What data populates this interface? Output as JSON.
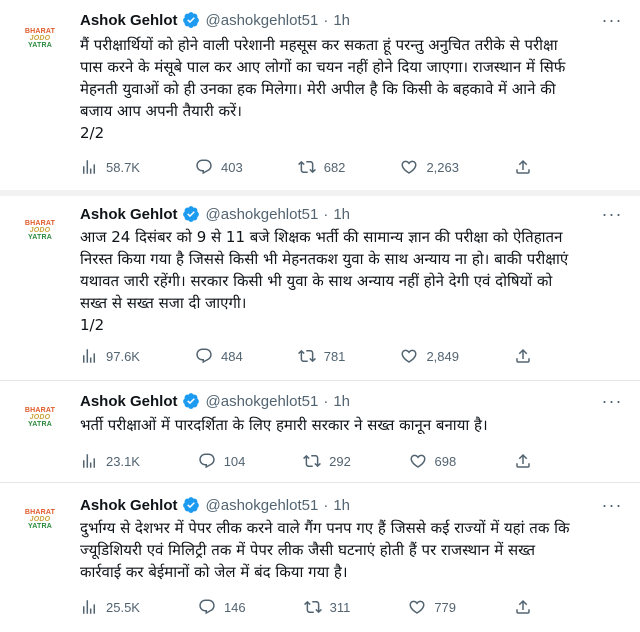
{
  "tweets": [
    {
      "author_name": "Ashok Gehlot",
      "handle": "@ashokgehlot51",
      "separator": "·",
      "time": "1h",
      "avatar_lines": [
        "BHARAT",
        "JODO",
        "YATRA"
      ],
      "lines": [
        "मैं परीक्षार्थियों को होने वाली परेशानी महसूस कर सकता हूं परन्तु अनुचित तरीके से परीक्षा",
        "पास करने के मंसूबे पाल कर आए लोगों का चयन नहीं होने दिया जाएगा। राजस्थान में सिर्फ",
        "मेहनती युवाओं को ही उनका हक मिलेगा। मेरी अपील है कि किसी के बहकावे में आने की",
        "बजाय आप अपनी तैयारी करें।",
        "2/2"
      ],
      "views": "58.7K",
      "replies": "403",
      "retweets": "682",
      "likes": "2,263"
    },
    {
      "author_name": "Ashok Gehlot",
      "handle": "@ashokgehlot51",
      "separator": "·",
      "time": "1h",
      "avatar_lines": [
        "BHARAT",
        "JODO",
        "YATRA"
      ],
      "lines": [
        "आज 24 दिसंबर को 9 से 11 बजे शिक्षक भर्ती की सामान्य ज्ञान की परीक्षा को ऐतिहातन",
        "निरस्त किया गया है जिससे किसी भी मेहनतकश युवा के साथ अन्याय ना हो। बाकी परीक्षाएं",
        "यथावत जारी रहेंगी। सरकार किसी भी युवा के साथ अन्याय नहीं होने देगी एवं दोषियों को",
        "सख्त से सख्त सजा दी जाएगी।",
        "1/2"
      ],
      "views": "97.6K",
      "replies": "484",
      "retweets": "781",
      "likes": "2,849"
    },
    {
      "author_name": "Ashok Gehlot",
      "handle": "@ashokgehlot51",
      "separator": "·",
      "time": "1h",
      "avatar_lines": [
        "BHARAT",
        "JODO",
        "YATRA"
      ],
      "lines": [
        "भर्ती परीक्षाओं में पारदर्शिता के लिए हमारी सरकार ने सख्त कानून बनाया है।"
      ],
      "views": "23.1K",
      "replies": "104",
      "retweets": "292",
      "likes": "698"
    },
    {
      "author_name": "Ashok Gehlot",
      "handle": "@ashokgehlot51",
      "separator": "·",
      "time": "1h",
      "avatar_lines": [
        "BHARAT",
        "JODO",
        "YATRA"
      ],
      "lines": [
        "दुर्भाग्य से देशभर में पेपर लीक करने वाले गैंग पनप गए हैं जिससे कई राज्यों में यहां तक कि",
        "ज्यूडिशियरी एवं मिलिट्री तक में पेपर लीक जैसी घटनाएं होती हैं पर राजस्थान में सख्त",
        "कार्रवाई कर बेईमानों को जेल में बंद किया गया है।"
      ],
      "views": "25.5K",
      "replies": "146",
      "retweets": "311",
      "likes": "779"
    }
  ],
  "colors": {
    "text": "#0f1419",
    "muted": "#536471",
    "verified": "#1d9bf0",
    "separator_band": "#f2f2f2"
  }
}
